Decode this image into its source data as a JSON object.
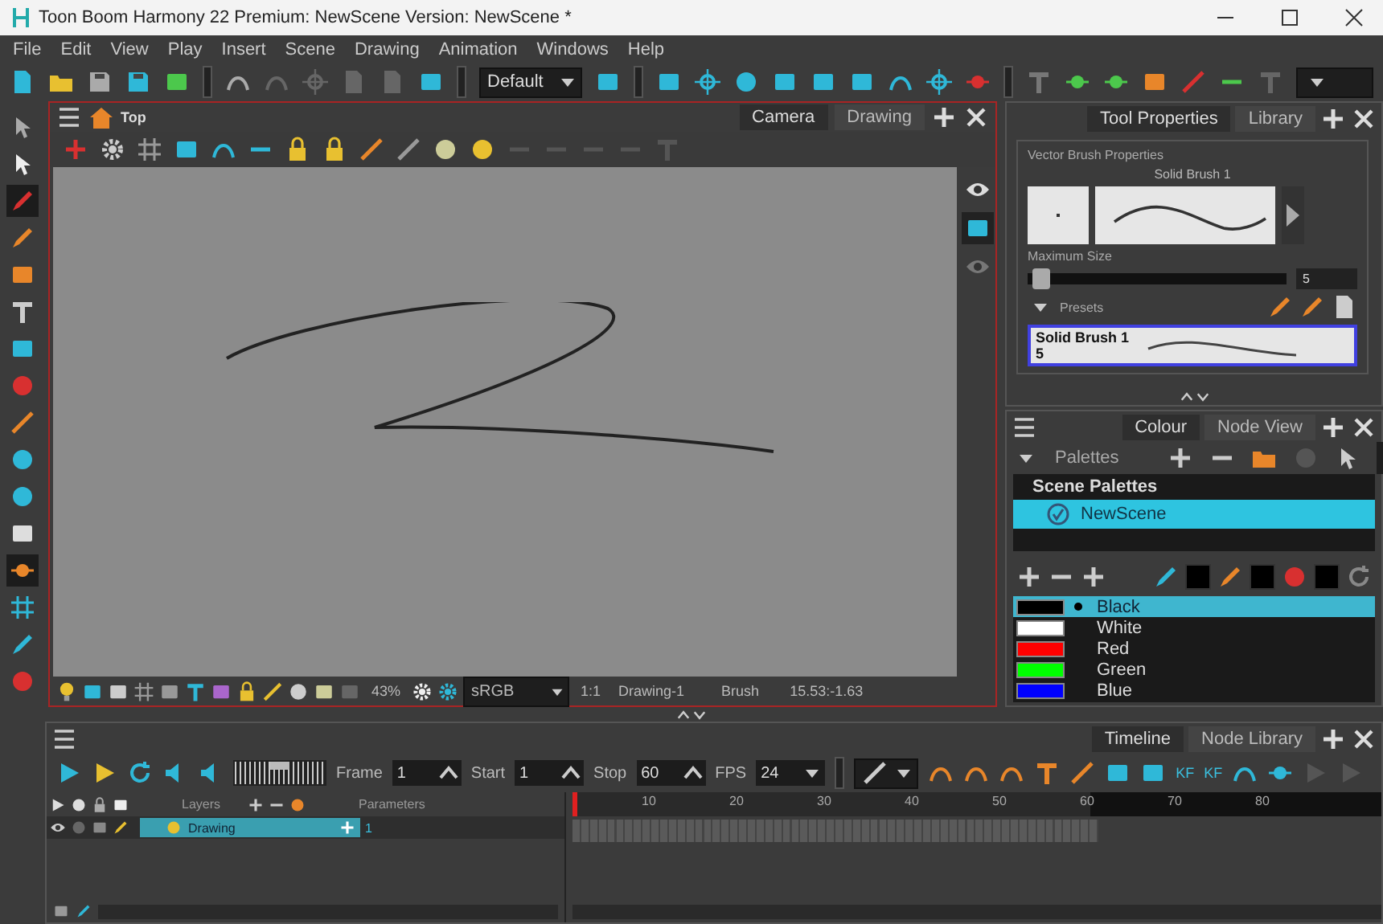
{
  "window": {
    "title": "Toon Boom Harmony 22 Premium: NewScene Version: NewScene *"
  },
  "menu": [
    "File",
    "Edit",
    "View",
    "Play",
    "Insert",
    "Scene",
    "Drawing",
    "Animation",
    "Windows",
    "Help"
  ],
  "toolbar": {
    "workspace": "Default"
  },
  "camera_view": {
    "breadcrumb": "Top",
    "tabs": [
      {
        "label": "Camera",
        "selected": true
      },
      {
        "label": "Drawing",
        "selected": false
      }
    ],
    "status": {
      "zoom": "43%",
      "colour_space": "sRGB",
      "ratio": "1:1",
      "drawing": "Drawing-1",
      "tool": "Brush",
      "coordinates": "15.53:-1.63"
    }
  },
  "tool_properties": {
    "tabs": [
      {
        "label": "Tool Properties",
        "selected": true
      },
      {
        "label": "Library",
        "selected": false
      }
    ],
    "section": "Vector Brush Properties",
    "brush_name": "Solid Brush 1",
    "max_size_label": "Maximum Size",
    "max_size": {
      "level": 0.02,
      "value": "5"
    },
    "presets_label": "Presets",
    "presets": [
      {
        "name": "Solid Brush 1",
        "size": "5",
        "selected": true
      }
    ]
  },
  "colour": {
    "tabs": [
      {
        "label": "Colour",
        "selected": true
      },
      {
        "label": "Node View",
        "selected": false
      }
    ],
    "palettes_label": "Palettes",
    "palette_header": "Scene Palettes",
    "palettes": [
      {
        "name": "NewScene",
        "selected": true
      }
    ],
    "colours": [
      {
        "name": "Black",
        "color": "#000000",
        "selected": true
      },
      {
        "name": "White",
        "color": "#ffffff",
        "selected": false
      },
      {
        "name": "Red",
        "color": "#ff0000",
        "selected": false
      },
      {
        "name": "Green",
        "color": "#00ff00",
        "selected": false
      },
      {
        "name": "Blue",
        "color": "#0000ff",
        "selected": false
      }
    ]
  },
  "timeline": {
    "tabs": [
      {
        "label": "Timeline",
        "selected": true
      },
      {
        "label": "Node Library",
        "selected": false
      }
    ],
    "jog": {
      "level": 0.5
    },
    "fields": [
      {
        "label": "Frame",
        "value": "1"
      },
      {
        "label": "Start",
        "value": "1"
      },
      {
        "label": "Stop",
        "value": "60"
      },
      {
        "label": "FPS",
        "value": "24"
      }
    ],
    "keyframe_buttons": [
      "KF",
      "KF"
    ],
    "layers_header": "Layers",
    "parameters_header": "Parameters",
    "layers": [
      {
        "name": "Drawing",
        "value": "1",
        "selected": true
      }
    ],
    "ruler": [
      "10",
      "20",
      "30",
      "40",
      "50",
      "60",
      "70",
      "80"
    ]
  }
}
